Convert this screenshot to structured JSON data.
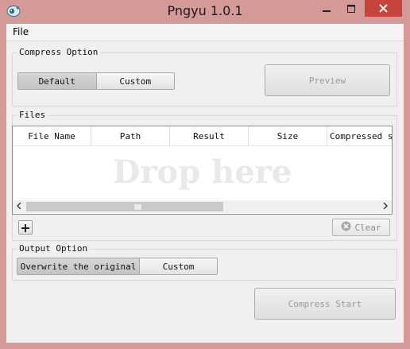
{
  "window": {
    "title": "Pngyu 1.0.1"
  },
  "menu": {
    "file": "File"
  },
  "compress_option": {
    "label": "Compress Option",
    "options": [
      "Default",
      "Custom"
    ],
    "selected": "Default",
    "preview": "Preview"
  },
  "files": {
    "label": "Files",
    "columns": [
      "File Name",
      "Path",
      "Result",
      "Size",
      "Compressed s"
    ],
    "drop_hint": "Drop here",
    "clear": "Clear"
  },
  "output_option": {
    "label": "Output Option",
    "options": [
      "Overwrite the original",
      "Custom"
    ],
    "selected": "Overwrite the original"
  },
  "compress_start": "Compress Start"
}
